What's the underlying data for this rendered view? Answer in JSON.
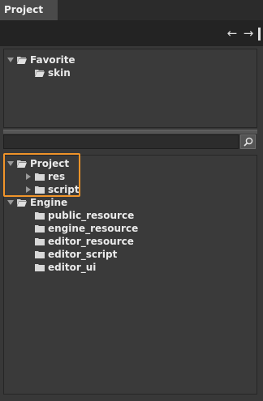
{
  "window": {
    "tab_title": "Project"
  },
  "toolbar": {
    "back_icon": "←",
    "forward_icon": "→",
    "accent": "#f0942a"
  },
  "favorites": {
    "root": {
      "label": "Favorite",
      "expanded": true
    },
    "items": [
      {
        "label": "skin"
      }
    ]
  },
  "search": {
    "value": "",
    "placeholder": ""
  },
  "tree": {
    "project": {
      "label": "Project",
      "expanded": true,
      "children": [
        {
          "label": "res",
          "expanded": false
        },
        {
          "label": "script",
          "expanded": false
        }
      ]
    },
    "engine": {
      "label": "Engine",
      "expanded": true,
      "children": [
        {
          "label": "public_resource"
        },
        {
          "label": "engine_resource"
        },
        {
          "label": "editor_resource"
        },
        {
          "label": "editor_script"
        },
        {
          "label": "editor_ui"
        }
      ]
    }
  }
}
